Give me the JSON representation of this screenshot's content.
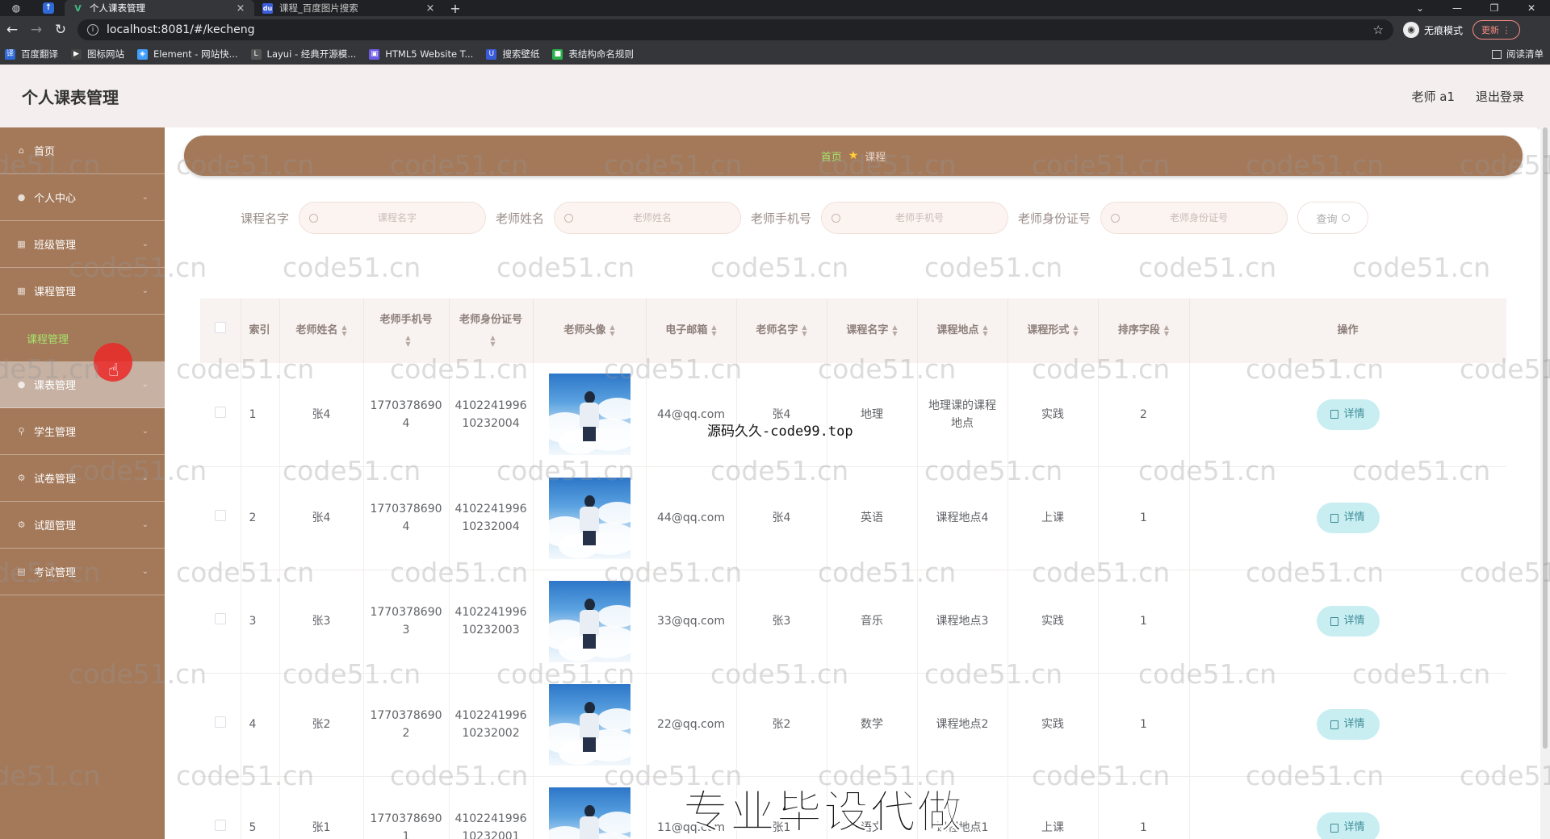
{
  "browser": {
    "tabs": [
      {
        "title": "个人课表管理",
        "active": true
      },
      {
        "title": "课程_百度图片搜索",
        "active": false
      }
    ],
    "url": "localhost:8081/#/kecheng",
    "incognito_label": "无痕模式",
    "update_label": "更新",
    "bookmarks": [
      {
        "label": "百度翻译",
        "color": "#2f6ad8",
        "glyph": "译"
      },
      {
        "label": "图标网站",
        "color": "#444444",
        "glyph": "▶"
      },
      {
        "label": "Element - 网站快...",
        "color": "#409eff",
        "glyph": "◈"
      },
      {
        "label": "Layui - 经典开源模...",
        "color": "#555555",
        "glyph": "L"
      },
      {
        "label": "HTML5 Website T...",
        "color": "#6c5ce7",
        "glyph": "▣"
      },
      {
        "label": "搜索壁纸",
        "color": "#3a5bd9",
        "glyph": "U"
      },
      {
        "label": "表结构命名规则",
        "color": "#2bb24c",
        "glyph": "■"
      }
    ],
    "reading_list_label": "阅读清单"
  },
  "header": {
    "title": "个人课表管理",
    "user": "老师 a1",
    "logout": "退出登录"
  },
  "sidebar": {
    "items": [
      {
        "label": "首页",
        "icon": "home-icon",
        "chevron": false
      },
      {
        "label": "个人中心",
        "icon": "user-icon",
        "chevron": true
      },
      {
        "label": "班级管理",
        "icon": "grid-icon",
        "chevron": true
      },
      {
        "label": "课程管理",
        "icon": "grid-icon",
        "chevron": true
      },
      {
        "label": "课表管理",
        "icon": "user-icon",
        "chevron": true
      },
      {
        "label": "学生管理",
        "icon": "pin-icon",
        "chevron": true
      },
      {
        "label": "试卷管理",
        "icon": "gear-icon",
        "chevron": true
      },
      {
        "label": "试题管理",
        "icon": "gear-icon",
        "chevron": true
      },
      {
        "label": "考试管理",
        "icon": "doc-icon",
        "chevron": true
      }
    ],
    "submenu_label": "课程管理"
  },
  "breadcrumb": {
    "home": "首页",
    "current": "课程"
  },
  "filters": [
    {
      "label": "课程名字",
      "placeholder": "课程名字"
    },
    {
      "label": "老师姓名",
      "placeholder": "老师姓名"
    },
    {
      "label": "老师手机号",
      "placeholder": "老师手机号"
    },
    {
      "label": "老师身份证号",
      "placeholder": "老师身份证号"
    }
  ],
  "query_label": "查询",
  "table": {
    "columns": [
      "索引",
      "老师姓名",
      "老师手机号",
      "老师身份证号",
      "老师头像",
      "电子邮箱",
      "老师名字",
      "课程名字",
      "课程地点",
      "课程形式",
      "排序字段",
      "操作"
    ],
    "detail_label": "详情",
    "rows": [
      {
        "index": "1",
        "teacher_name": "张4",
        "phone": "17703786904",
        "id_card": "410224199610232004",
        "email": "44@qq.com",
        "teacher_mingzi": "张4",
        "course": "地理",
        "location": "地理课的课程地点",
        "form": "实践",
        "sort": "2"
      },
      {
        "index": "2",
        "teacher_name": "张4",
        "phone": "17703786904",
        "id_card": "410224199610232004",
        "email": "44@qq.com",
        "teacher_mingzi": "张4",
        "course": "英语",
        "location": "课程地点4",
        "form": "上课",
        "sort": "1"
      },
      {
        "index": "3",
        "teacher_name": "张3",
        "phone": "17703786903",
        "id_card": "410224199610232003",
        "email": "33@qq.com",
        "teacher_mingzi": "张3",
        "course": "音乐",
        "location": "课程地点3",
        "form": "实践",
        "sort": "1"
      },
      {
        "index": "4",
        "teacher_name": "张2",
        "phone": "17703786902",
        "id_card": "410224199610232002",
        "email": "22@qq.com",
        "teacher_mingzi": "张2",
        "course": "数学",
        "location": "课程地点2",
        "form": "实践",
        "sort": "1"
      },
      {
        "index": "5",
        "teacher_name": "张1",
        "phone": "17703786901",
        "id_card": "410224199610232001",
        "email": "11@qq.com",
        "teacher_mingzi": "张1",
        "course": "语文",
        "location": "课程地点1",
        "form": "上课",
        "sort": "1"
      }
    ]
  },
  "overlays": {
    "watermark": "code51.cn",
    "source_text": "源码久久-code99.top",
    "promo_text": "专业毕设代做"
  },
  "colors": {
    "sidebar": "#a4795a",
    "accent_green": "#a5e46b",
    "detail_button": "#c8eef2",
    "header_bg": "#f5eeee"
  }
}
